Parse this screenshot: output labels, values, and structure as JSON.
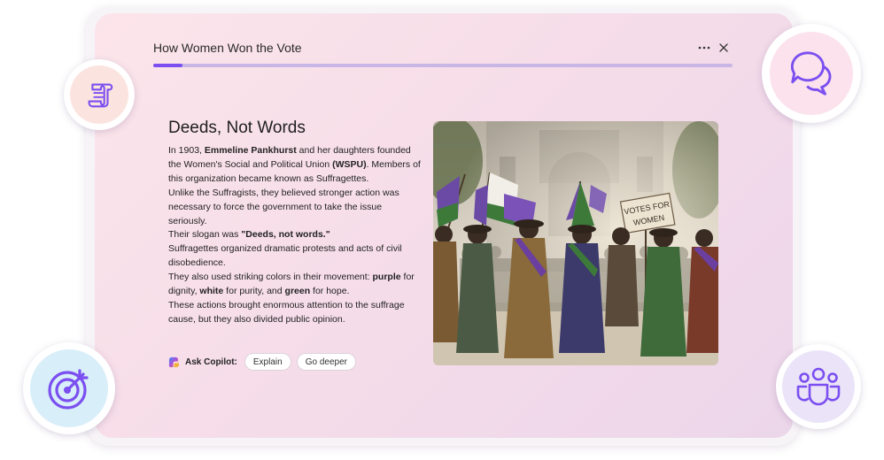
{
  "lesson": {
    "title": "How Women Won the Vote",
    "progress_fraction": 0.05
  },
  "content": {
    "heading": "Deeds, Not Words",
    "paragraphs": [
      [
        {
          "t": "In 1903, "
        },
        {
          "t": "Emmeline Pankhurst",
          "b": true
        },
        {
          "t": " and her daughters founded the Women's Social and Political Union "
        },
        {
          "t": "(WSPU)",
          "b": true
        },
        {
          "t": ". Members of this organization became known as Suffragettes."
        }
      ],
      [
        {
          "t": "Unlike the Suffragists, they believed stronger action was necessary to force the government to take the issue seriously."
        }
      ],
      [
        {
          "t": "Their slogan was "
        },
        {
          "t": "\"Deeds, not words.\"",
          "b": true
        }
      ],
      [
        {
          "t": "Suffragettes organized dramatic protests and acts of civil disobedience."
        }
      ],
      [
        {
          "t": "They also used striking colors in their movement: "
        },
        {
          "t": "purple",
          "b": true
        },
        {
          "t": " for dignity, "
        },
        {
          "t": "white",
          "b": true
        },
        {
          "t": " for purity, and "
        },
        {
          "t": "green",
          "b": true
        },
        {
          "t": " for hope."
        }
      ],
      [
        {
          "t": "These actions brought enormous attention to the suffrage cause, but they also divided public opinion."
        }
      ]
    ]
  },
  "copilot": {
    "label": "Ask Copilot:",
    "chips": [
      "Explain",
      "Go deeper"
    ]
  },
  "illustration": {
    "sign_text_line1": "VOTES FOR",
    "sign_text_line2": "WOMEN"
  },
  "icons": {
    "more": "more-horizontal-icon",
    "close": "close-icon",
    "copilot": "copilot-logo-icon",
    "badges": [
      "scroll-icon",
      "chat-bubbles-icon",
      "target-arrow-icon",
      "people-team-icon"
    ]
  },
  "colors": {
    "accent": "#7b4ff0",
    "accent_track": "#c8b7e6",
    "card_gradient_start": "#fce5ea",
    "card_gradient_end": "#ecd6ea",
    "suffragette_purple": "#6b3fa0",
    "suffragette_green": "#3d7a3a"
  }
}
